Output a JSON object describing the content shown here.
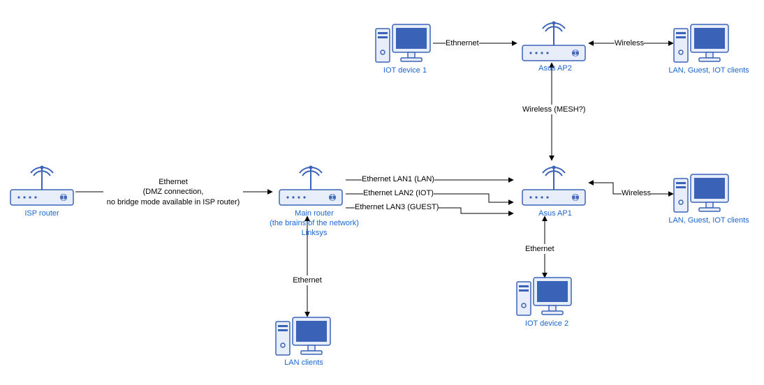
{
  "diagram": {
    "nodes": {
      "isp_router": {
        "label": "ISP router"
      },
      "main_router": {
        "label": "Main router\n(the brains of the network)\nLinksys"
      },
      "asus_ap1": {
        "label": "Asus AP1"
      },
      "asus_ap2": {
        "label": "Asus AP2"
      },
      "iot1": {
        "label": "IOT device 1"
      },
      "iot2": {
        "label": "IOT device 2"
      },
      "lan_clients": {
        "label": "LAN clients"
      },
      "clients_top": {
        "label": "LAN, Guest, IOT clients"
      },
      "clients_mid": {
        "label": "LAN, Guest, IOT clients"
      }
    },
    "edges": {
      "isp_main": {
        "label": "Ethernet\n(DMZ connection,\nno bridge mode available in ISP router)"
      },
      "main_ap1_lan1": {
        "label": "Ethernet LAN1 (LAN)"
      },
      "main_ap1_lan2": {
        "label": "Ethernet LAN2 (IOT)"
      },
      "main_ap1_lan3": {
        "label": "Ethernet LAN3 (GUEST)"
      },
      "main_lan": {
        "label": "Ethernet"
      },
      "ap1_iot2": {
        "label": "Ethernet"
      },
      "ap1_ap2": {
        "label": "Wireless (MESH?)"
      },
      "iot1_ap2": {
        "label": "Ethnernet"
      },
      "clientsT_ap2": {
        "label": "Wireless"
      },
      "clientsM_ap1": {
        "label": "Wireless"
      }
    }
  }
}
